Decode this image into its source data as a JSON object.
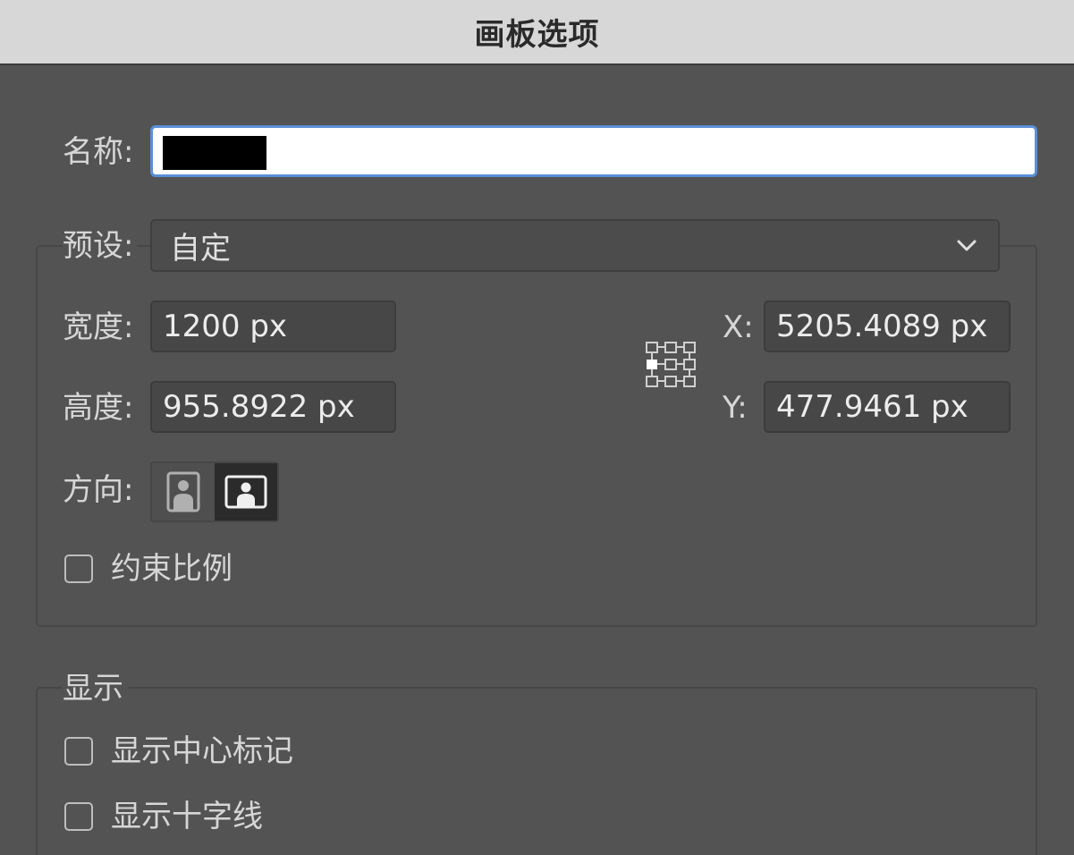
{
  "window": {
    "title": "画板选项"
  },
  "name": {
    "label": "名称:",
    "value": ""
  },
  "preset": {
    "label": "预设:",
    "value": "自定"
  },
  "width": {
    "label": "宽度:",
    "value": "1200 px"
  },
  "height": {
    "label": "高度:",
    "value": "955.8922 px"
  },
  "x": {
    "label": "X:",
    "value": "5205.4089 px"
  },
  "y": {
    "label": "Y:",
    "value": "477.9461 px"
  },
  "orientation": {
    "label": "方向:",
    "selected": "landscape"
  },
  "constrain": {
    "label": "约束比例",
    "checked": false
  },
  "display": {
    "section_label": "显示",
    "center_mark": {
      "label": "显示中心标记",
      "checked": false
    },
    "cross_hairs": {
      "label": "显示十字线",
      "checked": false
    }
  },
  "colors": {
    "accent": "#5a8fd6",
    "background": "#535353"
  }
}
